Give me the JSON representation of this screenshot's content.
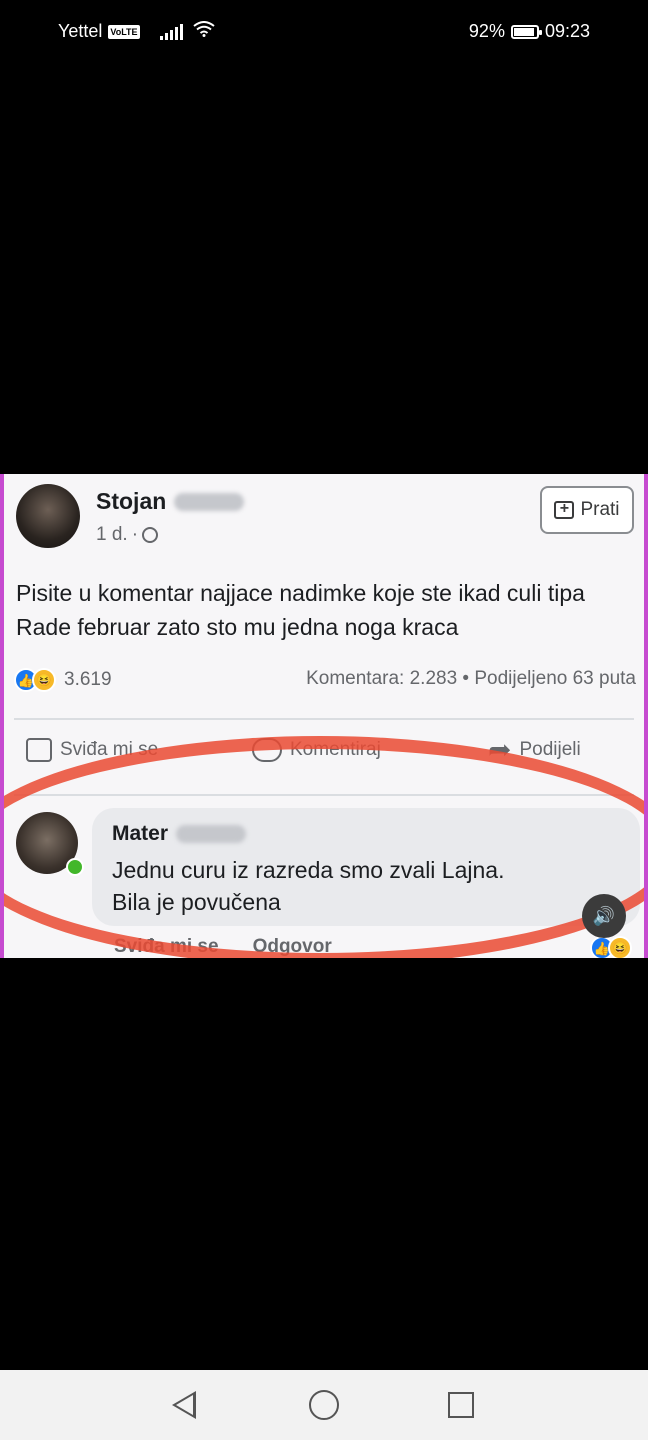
{
  "status_bar": {
    "carrier": "Yettel",
    "volte": "VoLTE",
    "battery_percent": "92%",
    "battery_level": 0.92,
    "time": "09:23"
  },
  "post": {
    "author": "Stojan",
    "time": "1 d.",
    "follow_label": "Prati",
    "text": "Pisite u komentar najjace nadimke koje ste ikad culi tipa Rade februar zato sto mu jedna noga kraca",
    "reactions_count": "3.619",
    "comments_shares": "Komentara: 2.283 • Podijeljeno 63 puta",
    "actions": {
      "like": "Sviđa mi se",
      "comment": "Komentiraj",
      "share": "Podijeli"
    },
    "accent_color": "#1877f2",
    "highlight_color": "#ea4a33"
  },
  "comment": {
    "author": "Mater",
    "line1": "Jednu curu iz razreda smo zvali Lajna.",
    "line2": "Bila je povučena",
    "like": "Sviđa mi se",
    "reply": "Odgovor"
  },
  "icons": [
    "volte-icon",
    "signal-icon",
    "wifi-icon",
    "battery-icon",
    "globe-icon",
    "follow-icon",
    "like-icon",
    "comment-icon",
    "share-icon",
    "sound-icon",
    "back-icon",
    "home-icon",
    "recent-apps-icon"
  ]
}
